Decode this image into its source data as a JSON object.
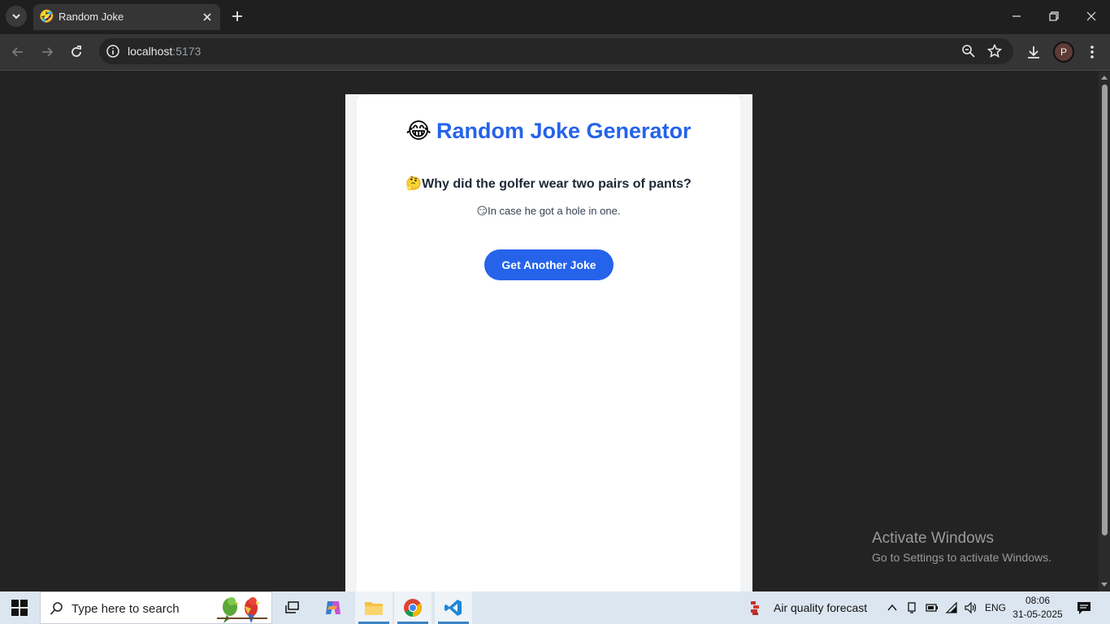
{
  "browser": {
    "tab_title": "Random Joke",
    "tab_favicon": "🤣",
    "url_host": "localhost",
    "url_port": ":5173"
  },
  "profile": {
    "initial": "P",
    "color": "#5e3b37"
  },
  "app": {
    "title_emoji": "😂",
    "title_text": "Random Joke Generator",
    "setup_emoji": "🤔",
    "setup_text": "Why did the golfer wear two pairs of pants?",
    "punchline_emoji": "😏",
    "punchline_text": "In case he got a hole in one.",
    "button_label": "Get Another Joke",
    "accent_color": "#2563eb"
  },
  "watermark": {
    "line1": "Activate Windows",
    "line2": "Go to Settings to activate Windows."
  },
  "taskbar": {
    "search_placeholder": "Type here to search",
    "weather_label": "Air quality forecast",
    "language": "ENG",
    "time": "08:06",
    "date": "31-05-2025"
  }
}
